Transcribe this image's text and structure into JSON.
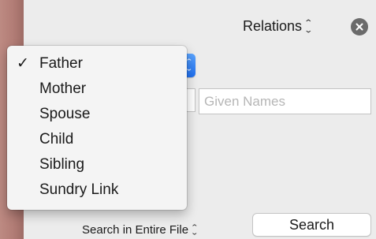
{
  "header": {
    "relations_label": "Relations",
    "updown_icon": "updown-chevron-icon",
    "close_icon": "close-icon"
  },
  "relation_menu": {
    "selected": "Father",
    "items": [
      {
        "label": "Father",
        "checked": true
      },
      {
        "label": "Mother",
        "checked": false
      },
      {
        "label": "Spouse",
        "checked": false
      },
      {
        "label": "Child",
        "checked": false
      },
      {
        "label": "Sibling",
        "checked": false
      },
      {
        "label": "Sundry Link",
        "checked": false
      }
    ],
    "check_mark": "✓"
  },
  "name_fields": {
    "surname_value": "",
    "given_names_placeholder": "Given Names",
    "given_names_value": ""
  },
  "footer": {
    "scope_label": "Search in Entire File",
    "search_button_label": "Search"
  },
  "colors": {
    "accent_blue": "#1f6ff0",
    "window_background": "#ececec",
    "side_strip": "#b27d76"
  }
}
